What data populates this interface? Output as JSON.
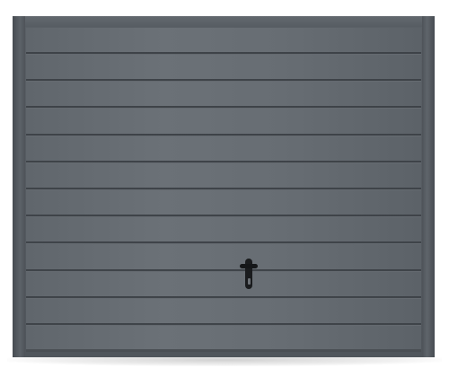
{
  "scene": {
    "subject": "sectional-garage-door",
    "color": "#676d73",
    "frame_color": "#565c62",
    "rib_color": "#3c4146",
    "handle_color": "#17191b",
    "rib_count": 11
  }
}
